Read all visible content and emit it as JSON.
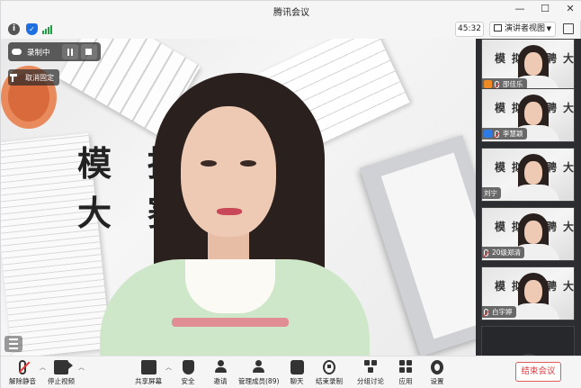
{
  "window": {
    "title": "腾讯会议"
  },
  "status": {
    "timer": "45:32",
    "view_mode": "演讲者视图"
  },
  "recording": {
    "label": "录制中",
    "unpin_label": "取消固定"
  },
  "main": {
    "banner": "模拟招聘大赛"
  },
  "participants": [
    {
      "name": "邵佳乐",
      "avatar_color": "#f08a24"
    },
    {
      "name": "李慧颖",
      "avatar_color": "#2d7be6"
    },
    {
      "name": "刘宁",
      "avatar_color": ""
    },
    {
      "name": "20级郑清",
      "avatar_color": ""
    },
    {
      "name": "白宇婷",
      "avatar_color": ""
    }
  ],
  "toolbar": {
    "unmute": "解除静音",
    "stop_video": "停止视频",
    "share": "共享屏幕",
    "security": "安全",
    "invite": "邀请",
    "members": "管理成员(89)",
    "chat": "聊天",
    "end_record": "结束录制",
    "breakout": "分组讨论",
    "apps": "应用",
    "settings": "设置",
    "end_meeting": "结束会议"
  },
  "colors": {
    "accent": "#1e6fe0",
    "danger": "#e0393e",
    "signal": "#21a043"
  }
}
